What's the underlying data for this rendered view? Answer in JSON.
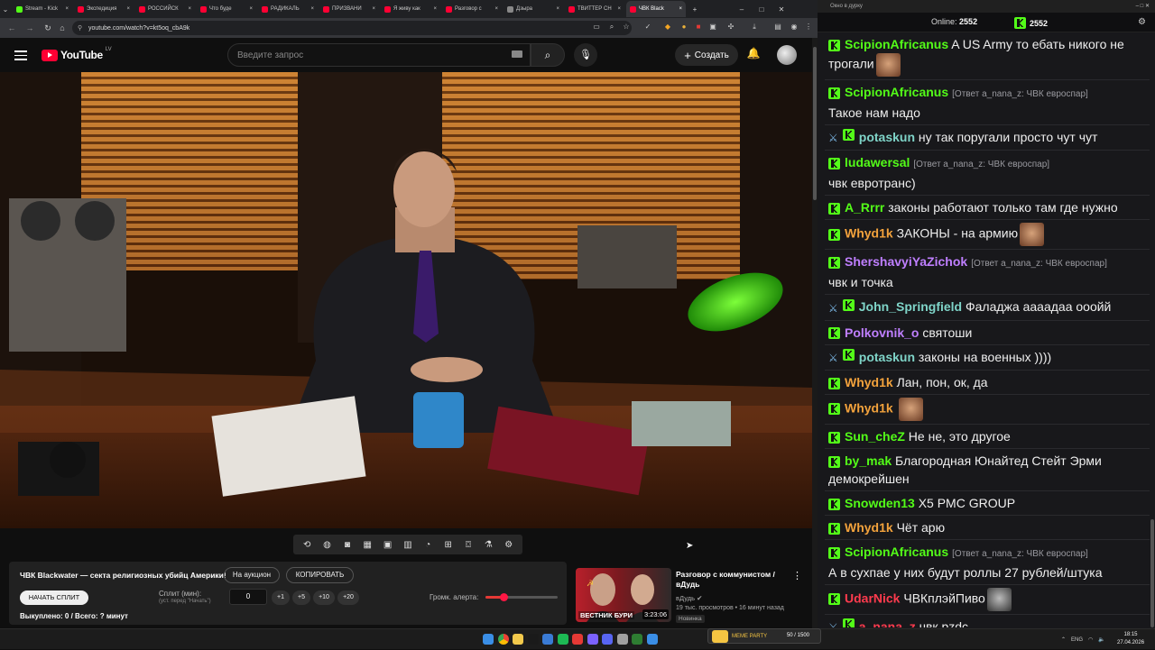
{
  "browser": {
    "tabs": [
      {
        "title": "Stream - Kick",
        "color": "#53fc18"
      },
      {
        "title": "Экспедиция",
        "color": "#ff0033"
      },
      {
        "title": "РОССИЙСК",
        "color": "#ff0033"
      },
      {
        "title": "Что буде",
        "color": "#ff0033"
      },
      {
        "title": "РАДИКАЛЬ",
        "color": "#ff0033"
      },
      {
        "title": "ПРИЗВАНИ",
        "color": "#ff0033"
      },
      {
        "title": "Я живу как",
        "color": "#ff0033"
      },
      {
        "title": "Разговор с",
        "color": "#ff0033"
      },
      {
        "title": "Дзыра",
        "color": "#888888"
      },
      {
        "title": "ТВИТТЕР СН",
        "color": "#ff0033"
      },
      {
        "title": "ЧВК Black",
        "color": "#ff0033"
      }
    ],
    "url": "youtube.com/watch?v=kt5oq_cbA9k"
  },
  "youtube": {
    "logo_text": "YouTube",
    "region": "LV",
    "search_placeholder": "Введите запрос",
    "create_label": "Создать"
  },
  "split_panel": {
    "title": "ЧВК Blackwater — секта религиозных убийц Америки!",
    "auction_label": "На аукцион",
    "copy_label": "КОПИРОВАТЬ",
    "start_label": "НАЧАТЬ СПЛИТ",
    "split_label": "Сплит (мин):",
    "split_hint": "(уст. перед \"Начать\")",
    "split_value": "0",
    "increments": [
      "+1",
      "+5",
      "+10",
      "+20"
    ],
    "volume_label": "Громк. алерта:",
    "volume_level": 0.25,
    "sold_out": "Выкуплено: 0 / Всего: ? минут"
  },
  "recommendation": {
    "thumb_caption": "ВЕСТНИК БУРИ",
    "duration": "3:23:06",
    "title": "Разговор с коммунистом / вДудь",
    "channel": "вДудь",
    "meta": "19 тыс. просмотров • 16 минут назад",
    "badge": "Новинка"
  },
  "chat_window": {
    "title": "Окно в дурку",
    "online_label": "Online:",
    "online_count": "2552",
    "viewers": "2552"
  },
  "chat": [
    {
      "user": "ScipionAfricanus",
      "color": "#53fc18",
      "sword": false,
      "reply": "",
      "text": "A US Army то ебать никого не трогали",
      "emote": "face"
    },
    {
      "user": "ScipionAfricanus",
      "color": "#53fc18",
      "sword": false,
      "reply": "[Ответ a_nana_z: ЧВК евроспар]",
      "text": "Такое нам надо",
      "emote": ""
    },
    {
      "user": "potaskun",
      "color": "#7fd4c8",
      "sword": true,
      "reply": "",
      "text": "ну так поругали просто чут чут",
      "emote": ""
    },
    {
      "user": "ludawersal",
      "color": "#53fc18",
      "sword": false,
      "reply": "[Ответ a_nana_z: ЧВК евроспар]",
      "text": "чвк евротранс)",
      "emote": ""
    },
    {
      "user": "A_Rrrr",
      "color": "#53fc18",
      "sword": false,
      "reply": "",
      "text": "законы работают только там где нужно",
      "emote": ""
    },
    {
      "user": "Whyd1k",
      "color": "#f2a23c",
      "sword": false,
      "reply": "",
      "text": "ЗАКОНЫ - на армию",
      "emote": "face"
    },
    {
      "user": "ShershavyiYaZichok",
      "color": "#bf7fff",
      "sword": false,
      "reply": "[Ответ a_nana_z: ЧВК евроспар]",
      "text": "чвк и точка",
      "emote": ""
    },
    {
      "user": "John_Springfield",
      "color": "#7fd4c8",
      "sword": true,
      "reply": "",
      "text": "Фаладжа аааадаа ооойй",
      "emote": ""
    },
    {
      "user": "Polkovnik_o",
      "color": "#bf7fff",
      "sword": false,
      "reply": "",
      "text": "святоши",
      "emote": ""
    },
    {
      "user": "potaskun",
      "color": "#7fd4c8",
      "sword": true,
      "reply": "",
      "text": "законы на военных ))))",
      "emote": ""
    },
    {
      "user": "Whyd1k",
      "color": "#f2a23c",
      "sword": false,
      "reply": "",
      "text": "Лан, пон, ок, да",
      "emote": ""
    },
    {
      "user": "Whyd1k",
      "color": "#f2a23c",
      "sword": false,
      "reply": "",
      "text": "",
      "emote": "face"
    },
    {
      "user": "Sun_cheZ",
      "color": "#53fc18",
      "sword": false,
      "reply": "",
      "text": "Не не, это другое",
      "emote": ""
    },
    {
      "user": "by_mak",
      "color": "#53fc18",
      "sword": false,
      "reply": "",
      "text": "Благородная Юнайтед Стейт Эрми демокрейшен",
      "emote": ""
    },
    {
      "user": "Snowden13",
      "color": "#53fc18",
      "sword": false,
      "reply": "",
      "text": "X5 PMC GROUP",
      "emote": ""
    },
    {
      "user": "Whyd1k",
      "color": "#f2a23c",
      "sword": false,
      "reply": "",
      "text": "Чёт арю",
      "emote": ""
    },
    {
      "user": "ScipionAfricanus",
      "color": "#53fc18",
      "sword": false,
      "reply": "[Ответ a_nana_z: ЧВК евроспар]",
      "text": "А в сухпае у них будут роллы 27 рублей/штука",
      "emote": ""
    },
    {
      "user": "UdarNick",
      "color": "#ff3b4e",
      "sword": false,
      "reply": "",
      "text": "ЧВКплэйПиво",
      "emote": "gray"
    },
    {
      "user": "a_nana_z",
      "color": "#ff3b4e",
      "sword": true,
      "reply": "",
      "text": "чвк pzdc",
      "emote": ""
    }
  ],
  "meme_party": {
    "label": "MEME PARTY",
    "count": "50 / 1500"
  },
  "taskbar": {
    "lang": "ENG",
    "time": "18:15",
    "date": "27.04.2026"
  }
}
